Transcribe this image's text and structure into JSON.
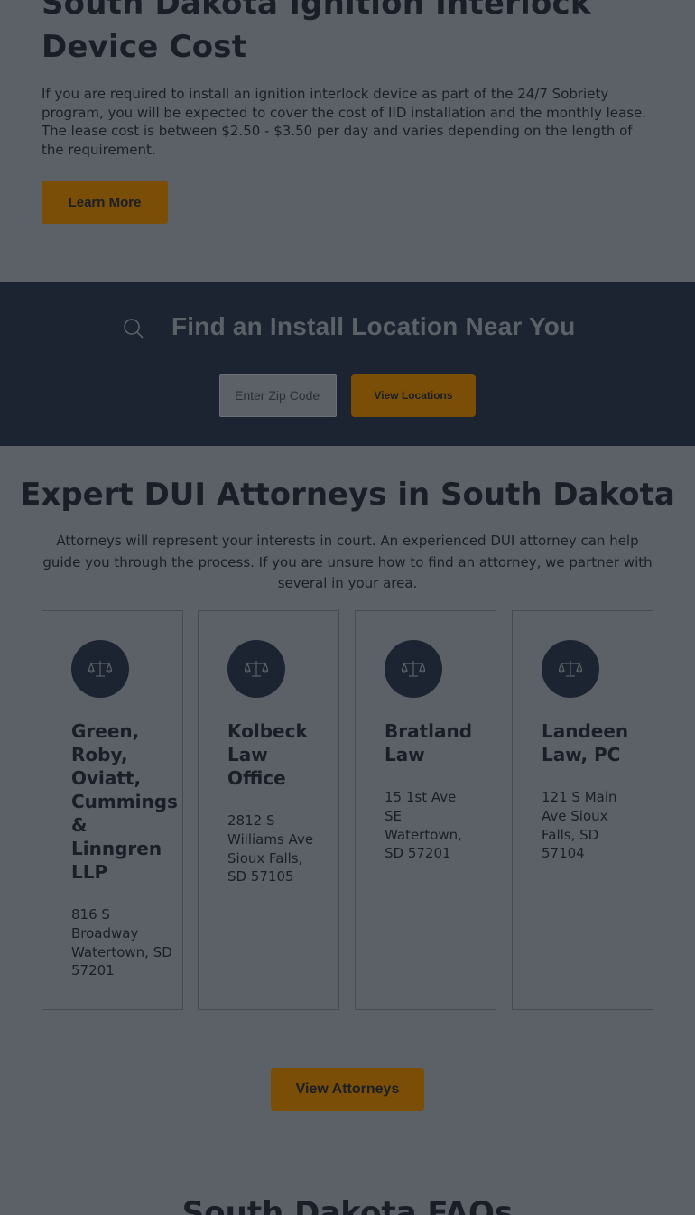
{
  "cost_section": {
    "title": "South Dakota Ignition Interlock Device Cost",
    "paragraph": "If you are required to install an ignition interlock device as part of the 24/7 Sobriety program, you will be expected to cover the cost of IID installation and the monthly lease. The lease cost is between $2.50 - $3.50 per day and varies depending on the length of the requirement.",
    "button_label": "Learn More"
  },
  "locator": {
    "icon": "search-icon",
    "title": "Find an Install Location Near You",
    "zip_placeholder": "Enter Zip Code",
    "button_label": "View Locations"
  },
  "attorneys": {
    "title": "Expert DUI Attorneys in South Dakota",
    "paragraph": "Attorneys will represent your interests in court. An experienced DUI attorney can help guide you through the process. If you are unsure how to find an attorney, we partner with several in your area.",
    "cards": [
      {
        "icon": "scales-icon",
        "name": "Green, Roby, Oviatt, Cummings & Linngren LLP",
        "address": "816 S Broadway Watertown, SD 57201"
      },
      {
        "icon": "scales-icon",
        "name": "Kolbeck Law Office",
        "address": "2812 S Williams Ave Sioux Falls, SD 57105"
      },
      {
        "icon": "scales-icon",
        "name": "Bratland Law",
        "address": "15 1st Ave SE Watertown, SD 57201"
      },
      {
        "icon": "scales-icon",
        "name": "Landeen Law, PC",
        "address": "121 S Main Ave Sioux Falls, SD 57104"
      }
    ],
    "button_label": "View Attorneys"
  },
  "faq": {
    "title": "South Dakota FAQs"
  },
  "colors": {
    "accent": "#7a4e07",
    "dark_band": "#1c2431",
    "overlay_bg": "#5c6168"
  }
}
